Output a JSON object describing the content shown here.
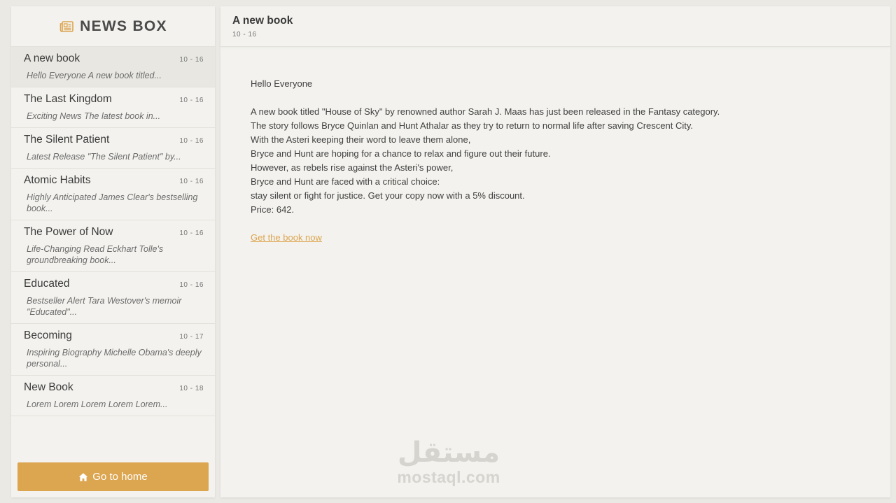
{
  "brand": {
    "title": "NEWS BOX",
    "icon": "newspaper-icon",
    "accent": "#dca550"
  },
  "news": [
    {
      "title": "A new book",
      "date": "10 - 16",
      "excerpt": "Hello Everyone A new book titled..."
    },
    {
      "title": "The Last Kingdom",
      "date": "10 - 16",
      "excerpt": "Exciting News The latest book in..."
    },
    {
      "title": "The Silent Patient",
      "date": "10 - 16",
      "excerpt": "Latest Release \"The Silent Patient\" by..."
    },
    {
      "title": "Atomic Habits",
      "date": "10 - 16",
      "excerpt": "Highly Anticipated James Clear's bestselling book..."
    },
    {
      "title": "The Power of Now",
      "date": "10 - 16",
      "excerpt": "Life-Changing Read Eckhart Tolle's groundbreaking book..."
    },
    {
      "title": "Educated",
      "date": "10 - 16",
      "excerpt": "Bestseller Alert Tara Westover's memoir \"Educated\"..."
    },
    {
      "title": "Becoming",
      "date": "10 - 17",
      "excerpt": "Inspiring Biography Michelle Obama's deeply personal..."
    },
    {
      "title": "New Book",
      "date": "10 - 18",
      "excerpt": "Lorem Lorem Lorem Lorem Lorem..."
    }
  ],
  "home_button": {
    "label": "Go to home",
    "icon": "home-icon"
  },
  "article": {
    "title": "A new book",
    "date": "10 - 16",
    "greeting": "Hello Everyone",
    "lines": [
      "A new book titled \"House of Sky\" by renowned author Sarah J. Maas has just been released in the Fantasy category.",
      "The story follows Bryce Quinlan and Hunt Athalar as they try to return to normal life after saving Crescent City.",
      "With the Asteri keeping their word to leave them alone,",
      "Bryce and Hunt are hoping for a chance to relax and figure out their future.",
      "However, as rebels rise against the Asteri's power,",
      "Bryce and Hunt are faced with a critical choice:",
      "stay silent or fight for justice. Get your copy now with a 5% discount.",
      "Price: 642."
    ],
    "cta": "Get the book now"
  },
  "watermark": {
    "arabic": "مستقل",
    "latin": "mostaql.com"
  }
}
